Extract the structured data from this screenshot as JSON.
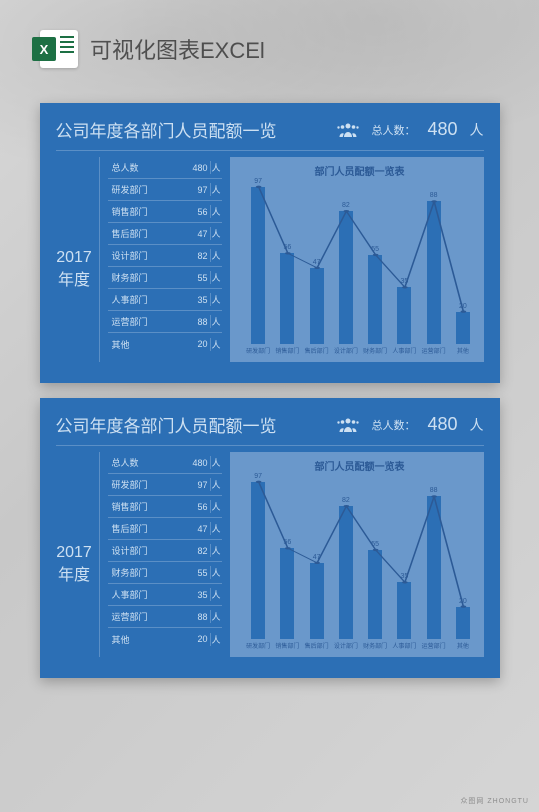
{
  "header": {
    "title": "可视化图表EXCEl"
  },
  "panel": {
    "title": "公司年度各部门人员配额一览",
    "total_label": "总人数：",
    "total_value": "480",
    "total_unit": "人",
    "year": "2017",
    "year_suffix": "年度",
    "suffix": "人",
    "table": [
      {
        "label": "总人数",
        "value": "480"
      },
      {
        "label": "研发部门",
        "value": "97"
      },
      {
        "label": "销售部门",
        "value": "56"
      },
      {
        "label": "售后部门",
        "value": "47"
      },
      {
        "label": "设计部门",
        "value": "82"
      },
      {
        "label": "财务部门",
        "value": "55"
      },
      {
        "label": "人事部门",
        "value": "35"
      },
      {
        "label": "运营部门",
        "value": "88"
      },
      {
        "label": "其他",
        "value": "20"
      }
    ],
    "chart_title": "部门人员配额一览表"
  },
  "chart_data": {
    "type": "bar",
    "title": "部门人员配额一览表",
    "categories": [
      "研发部门",
      "销售部门",
      "售后部门",
      "设计部门",
      "财务部门",
      "人事部门",
      "运营部门",
      "其他"
    ],
    "values": [
      97,
      56,
      47,
      82,
      55,
      35,
      88,
      20
    ],
    "ylim": [
      0,
      100
    ],
    "overlay_line": true
  },
  "watermark": "众图网 ZHONGTU"
}
